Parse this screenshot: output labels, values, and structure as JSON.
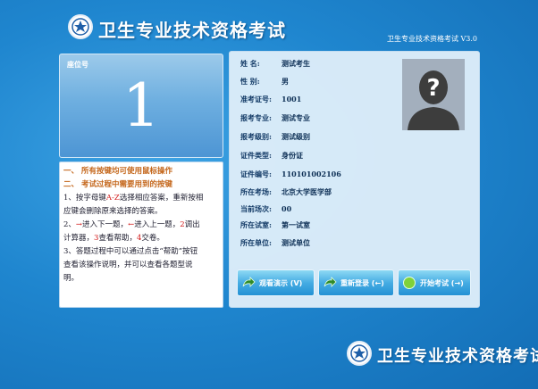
{
  "header": {
    "title": "卫生专业技术资格考试",
    "version": "卫生专业技术资格考试 V3.0"
  },
  "seat": {
    "label": "座位号",
    "number": "1"
  },
  "instructions": {
    "heading1": "一、 所有按键均可使用鼠标操作",
    "heading2": "二、 考试过程中需要用到的按键",
    "line1a": "1、按字母键",
    "line1key": "A-Z",
    "line1b": "选择相应答案，重新按相",
    "line2": "应键会删除原来选择的答案。",
    "line3a": "2、",
    "line3arrowR": "→",
    "line3b": "进入下一题，",
    "line3arrowL": "←",
    "line3c": "进入上一题，",
    "line3n2": "2",
    "line3d": "调出",
    "line4a": "计算器，",
    "line4n3": "3",
    "line4b": "查看帮助，",
    "line4n4": "4",
    "line4c": "交卷。",
    "line5": "3、答题过程中可以通过点击“帮助”按钮",
    "line6": "查看该操作说明，并可以查看各题型说",
    "line7": "明。"
  },
  "candidate": {
    "fields": [
      {
        "label": "姓    名:",
        "value": "测试考生"
      },
      {
        "label": "性    别:",
        "value": "男"
      },
      {
        "label": "准考证号:",
        "value": "1001"
      },
      {
        "label": "报考专业:",
        "value": "测试专业"
      },
      {
        "label": "报考级别:",
        "value": "测试级别"
      },
      {
        "label": "证件类型:",
        "value": "身份证"
      },
      {
        "label": "证件编号:",
        "value": "110101002106"
      },
      {
        "label": "所在考场:",
        "value": "北京大学医学部"
      },
      {
        "label": "当前场次:",
        "value": "00"
      },
      {
        "label": "所在试室:",
        "value": "第一试室"
      },
      {
        "label": "所在单位:",
        "value": "测试单位"
      }
    ]
  },
  "buttons": {
    "demo": "观看演示 (V)",
    "relogin": "重新登录 (←)",
    "start": "开始考试 (→)"
  },
  "footer": {
    "title": "卫生专业技术资格考试"
  },
  "colors": {
    "accent": "#1f86cf",
    "heading": "#c4661a",
    "key": "#d21818"
  }
}
